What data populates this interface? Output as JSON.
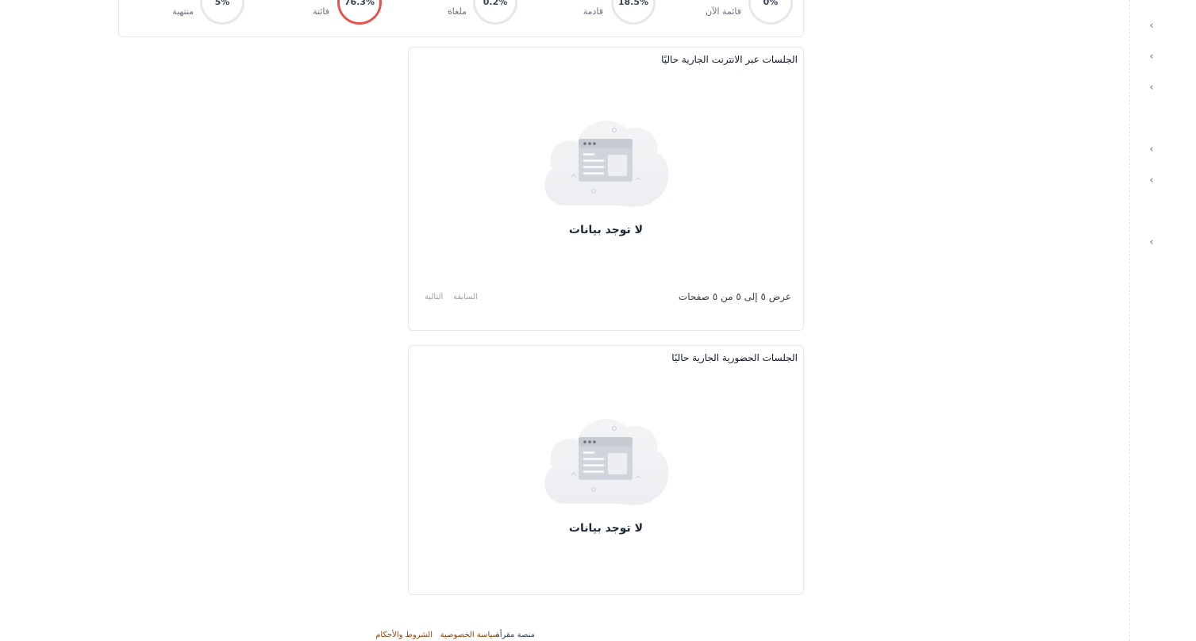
{
  "stats": [
    {
      "pct": "0%",
      "label": "قائمة الآن",
      "count": "-",
      "highlight": false
    },
    {
      "pct": "18.5%",
      "label": "قادمة",
      "count": "---",
      "highlight": false
    },
    {
      "pct": "0.2%",
      "label": "ملغاة",
      "count": "-",
      "highlight": false
    },
    {
      "pct": "76.3%",
      "label": "فائتة",
      "count": "---",
      "highlight": true
    },
    {
      "pct": "5%",
      "label": "منتهية",
      "count": "--",
      "highlight": false
    }
  ],
  "online_sessions": {
    "title": "الجلسات عبر الانترنت الجارية حاليًا",
    "empty_text": "لا توجد بيانات",
    "pager_info": "عرض ٥ إلى ٥ من ٥ صفحات",
    "prev_label": "السابقة",
    "next_label": "التالية"
  },
  "inperson_sessions": {
    "title": "الجلسات الحضورية الجارية حاليًا",
    "empty_text": "لا توجد بيانات"
  },
  "footer": {
    "brand": "منصة مقرأة",
    "privacy": "سياسة الخصوصية",
    "terms": "الشروط والأحكام"
  },
  "sidebar": {
    "chevrons": [
      "‹",
      "‹",
      "‹",
      "‹",
      "‹",
      "‹"
    ]
  },
  "colors": {
    "accent_red": "#e5534b",
    "ring_gray": "#e5e7eb",
    "link_brown": "#8b4513"
  },
  "icons": {
    "empty_state": "empty-window-cloud-icon",
    "sidebar": "chevron-left-icon"
  }
}
